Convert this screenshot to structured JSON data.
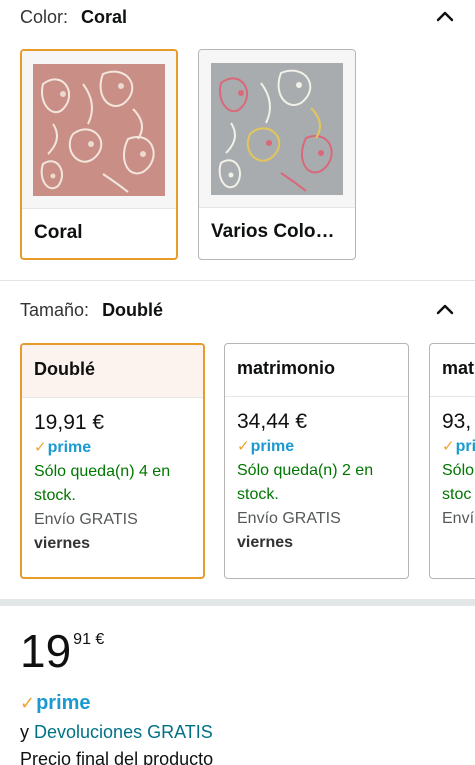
{
  "color_section": {
    "label": "Color:",
    "selected_value": "Coral",
    "options": [
      {
        "name": "Coral",
        "selected": true
      },
      {
        "name": "Varios Colo…",
        "selected": false
      }
    ]
  },
  "size_section": {
    "label": "Tamaño:",
    "selected_value": "Doublé",
    "options": [
      {
        "name": "Doublé",
        "price": "19,91 €",
        "prime": "prime",
        "stock": "Sólo queda(n) 4 en stock.",
        "shipping": "Envío GRATIS",
        "day": "viernes",
        "selected": true
      },
      {
        "name": "matrimonio",
        "price": "34,44 €",
        "prime": "prime",
        "stock": "Sólo queda(n) 2 en stock.",
        "shipping": "Envío GRATIS",
        "day": "viernes",
        "selected": false
      },
      {
        "name": "mat",
        "price": "93,",
        "prime": "pri",
        "stock": "Sólo stoc",
        "shipping": "Enví",
        "day": "",
        "selected": false
      }
    ]
  },
  "price_block": {
    "whole": "19",
    "fraction": "91 €",
    "prime": "prime",
    "returns_prefix": "y",
    "returns_link": "Devoluciones GRATIS",
    "final_text": "Precio final del producto"
  },
  "icons": {
    "collapse": "chevron-up-icon",
    "prime_check": "prime-check-icon"
  },
  "colors": {
    "selected_border": "#e89a2b",
    "prime_blue": "#1b9ad1",
    "stock_green": "#007600",
    "link_teal": "#007185",
    "coral_swatch": "#c98f86",
    "gray_swatch": "#a9acae"
  }
}
